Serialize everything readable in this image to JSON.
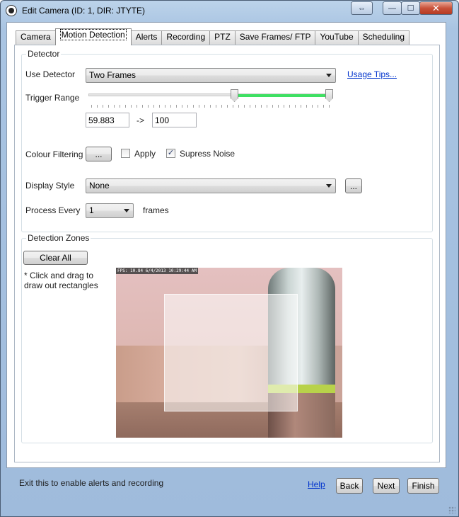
{
  "window": {
    "title": "Edit Camera (ID: 1, DIR: JTYTE)",
    "restore_glyph": "⇔",
    "minimize_glyph": "—",
    "maximize_glyph": "☐",
    "close_glyph": "✕"
  },
  "tabs": [
    {
      "label": "Camera",
      "active": false
    },
    {
      "label": "Motion Detection",
      "active": true
    },
    {
      "label": "Alerts",
      "active": false
    },
    {
      "label": "Recording",
      "active": false
    },
    {
      "label": "PTZ",
      "active": false
    },
    {
      "label": "Save Frames/ FTP",
      "active": false
    },
    {
      "label": "YouTube",
      "active": false
    },
    {
      "label": "Scheduling",
      "active": false
    }
  ],
  "detector": {
    "group_title": "Detector",
    "use_detector_label": "Use Detector",
    "use_detector_value": "Two Frames",
    "usage_tips_link": "Usage Tips...",
    "trigger_range_label": "Trigger Range",
    "trigger_min": "59.883",
    "trigger_arrow": "->",
    "trigger_max": "100",
    "trigger_range_fraction": {
      "low": 0.59883,
      "high": 1.0
    },
    "colour_filtering_label": "Colour Filtering",
    "colour_button": "...",
    "apply_label": "Apply",
    "apply_checked": false,
    "supress_noise_label": "Supress Noise",
    "supress_noise_checked": true,
    "check_glyph": "✓",
    "display_style_label": "Display Style",
    "display_style_value": "None",
    "display_style_button": "...",
    "process_every_label": "Process Every",
    "process_every_value": "1",
    "frames_label": "frames"
  },
  "zones": {
    "group_title": "Detection Zones",
    "clear_all_button": "Clear All",
    "hint": "* Click and drag to draw out rectangles",
    "camera_osd": "FPS: 10.84 6/4/2013 10:29:44 AM"
  },
  "footer": {
    "status_text": "Exit this to enable alerts and recording",
    "help_link": "Help",
    "back_button": "Back",
    "next_button": "Next",
    "finish_button": "Finish"
  },
  "colors": {
    "slider_range": "#3ee062",
    "link": "#0033cc",
    "close_button": "#c9523a"
  }
}
